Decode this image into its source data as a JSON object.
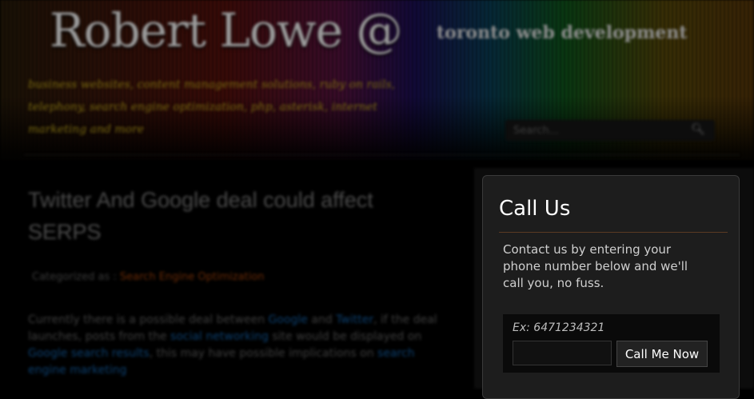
{
  "header": {
    "site_title": "Robert Lowe @",
    "tagline": "toronto web development",
    "services": "business websites, content management solutions, ruby on rails, telephony, search engine optimization, php, asterisk, internet marketing and more",
    "search_placeholder": "Search...",
    "search_icon": "magnifier-icon"
  },
  "post": {
    "title": "Twitter And Google deal could affect SERPS",
    "category_prefix": "Categorized as :",
    "category": "Search Engine Optimization",
    "body": {
      "t1": "Currently there is a possible deal between ",
      "l1": "Google",
      "t2": " and ",
      "l2": "Twitter",
      "t3": ", if the deal launches, posts from the ",
      "l3": "social networking",
      "t4": " site would be displayed on ",
      "l4": "Google search results",
      "t5": ", this may have possible implications on ",
      "l5": "search engine marketing"
    }
  },
  "widget": {
    "title": "Call Us",
    "text": "Contact us by entering your phone number below and we'll call you, no fuss.",
    "example": "Ex: 6471234321",
    "phone_value": "",
    "button_label": "Call Me Now"
  },
  "colors": {
    "link": "#0c3f6e",
    "category_link": "#6a2a06",
    "widget_bg": "#1d1d1d"
  }
}
